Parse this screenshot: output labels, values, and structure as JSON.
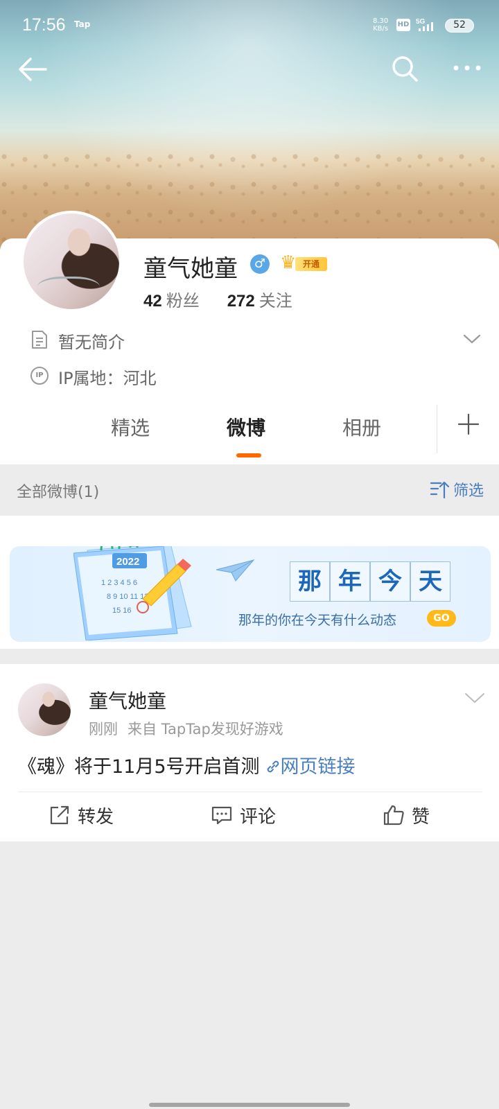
{
  "status_bar": {
    "time": "17:56",
    "tap_badge": "Tap",
    "net_speed_value": "8.30",
    "net_speed_unit": "KB/s",
    "hd": "HD",
    "network": "5G",
    "battery": "52"
  },
  "profile": {
    "name": "童气她童",
    "vip_label": "开通",
    "fans_count": "42",
    "fans_label": "粉丝",
    "following_count": "272",
    "following_label": "关注",
    "intro": "暂无简介",
    "ip_location": "IP属地：河北",
    "ip_icon_text": "IP"
  },
  "tabs": [
    {
      "label": "精选",
      "active": false
    },
    {
      "label": "微博",
      "active": true
    },
    {
      "label": "相册",
      "active": false
    }
  ],
  "filter_bar": {
    "all_label": "全部微博(1)",
    "filter_label": "筛选"
  },
  "banner": {
    "title_chars": [
      "那",
      "年",
      "今",
      "天"
    ],
    "subtitle": "那年的你在今天有什么动态",
    "go_label": "GO",
    "calendar_year": "2022"
  },
  "post": {
    "author": "童气她童",
    "time": "刚刚",
    "source": "来自 TapTap发现好游戏",
    "content": "《魂》将于11月5号开启首测",
    "link_label": "网页链接",
    "actions": {
      "repost": "转发",
      "comment": "评论",
      "like": "赞"
    }
  },
  "colors": {
    "accent_orange": "#ff6a00",
    "link_blue": "#4a7fbf",
    "page_bg": "#ececec"
  }
}
